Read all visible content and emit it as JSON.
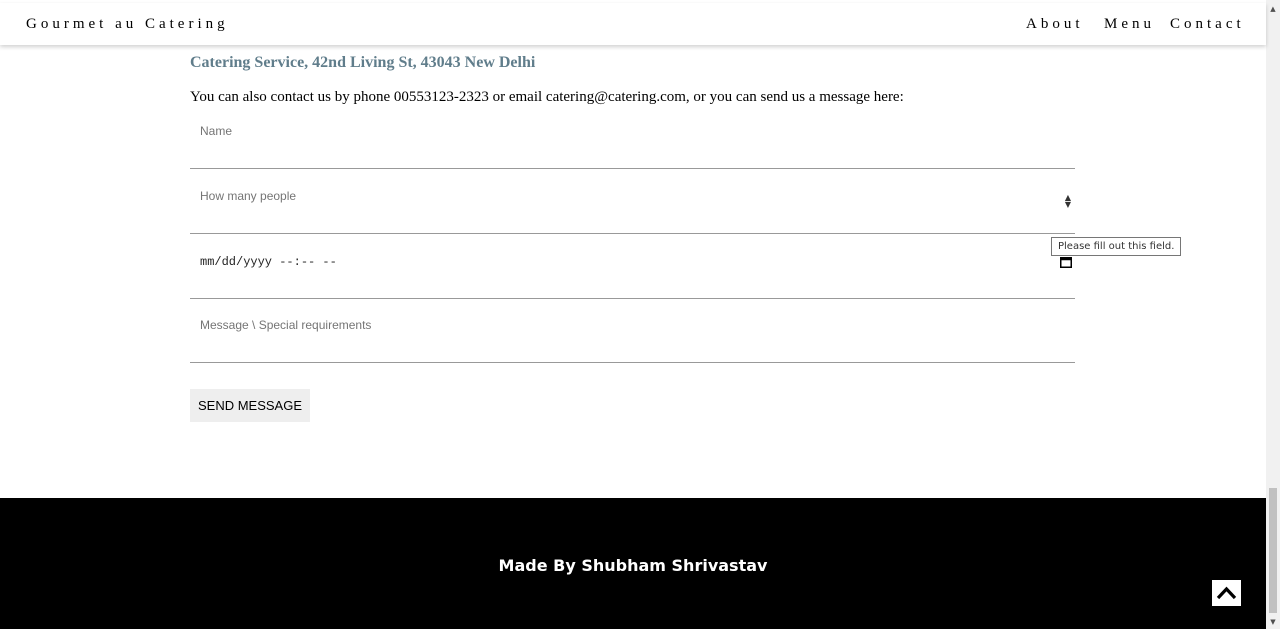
{
  "nav": {
    "brand": "Gourmet au Catering",
    "items": [
      "About",
      "Menu",
      "Contact"
    ]
  },
  "contact": {
    "address": "Catering Service, 42nd Living St, 43043 New Delhi",
    "intro": "You can also contact us by phone 00553123-2323 or email catering@catering.com, or you can send us a message here:",
    "fields": {
      "name_placeholder": "Name",
      "people_placeholder": "How many people",
      "date_placeholder": "mm/dd/yyyy --:-- --",
      "message_placeholder": "Message \\ Special requirements"
    },
    "validation_tooltip": "Please fill out this field.",
    "send_label": "SEND MESSAGE"
  },
  "footer": {
    "credit": "Made By Shubham Shrivastav"
  },
  "icons": {
    "to_top": "chevron-up-icon",
    "calendar": "calendar-icon",
    "spinner": "number-spinner-icon"
  }
}
